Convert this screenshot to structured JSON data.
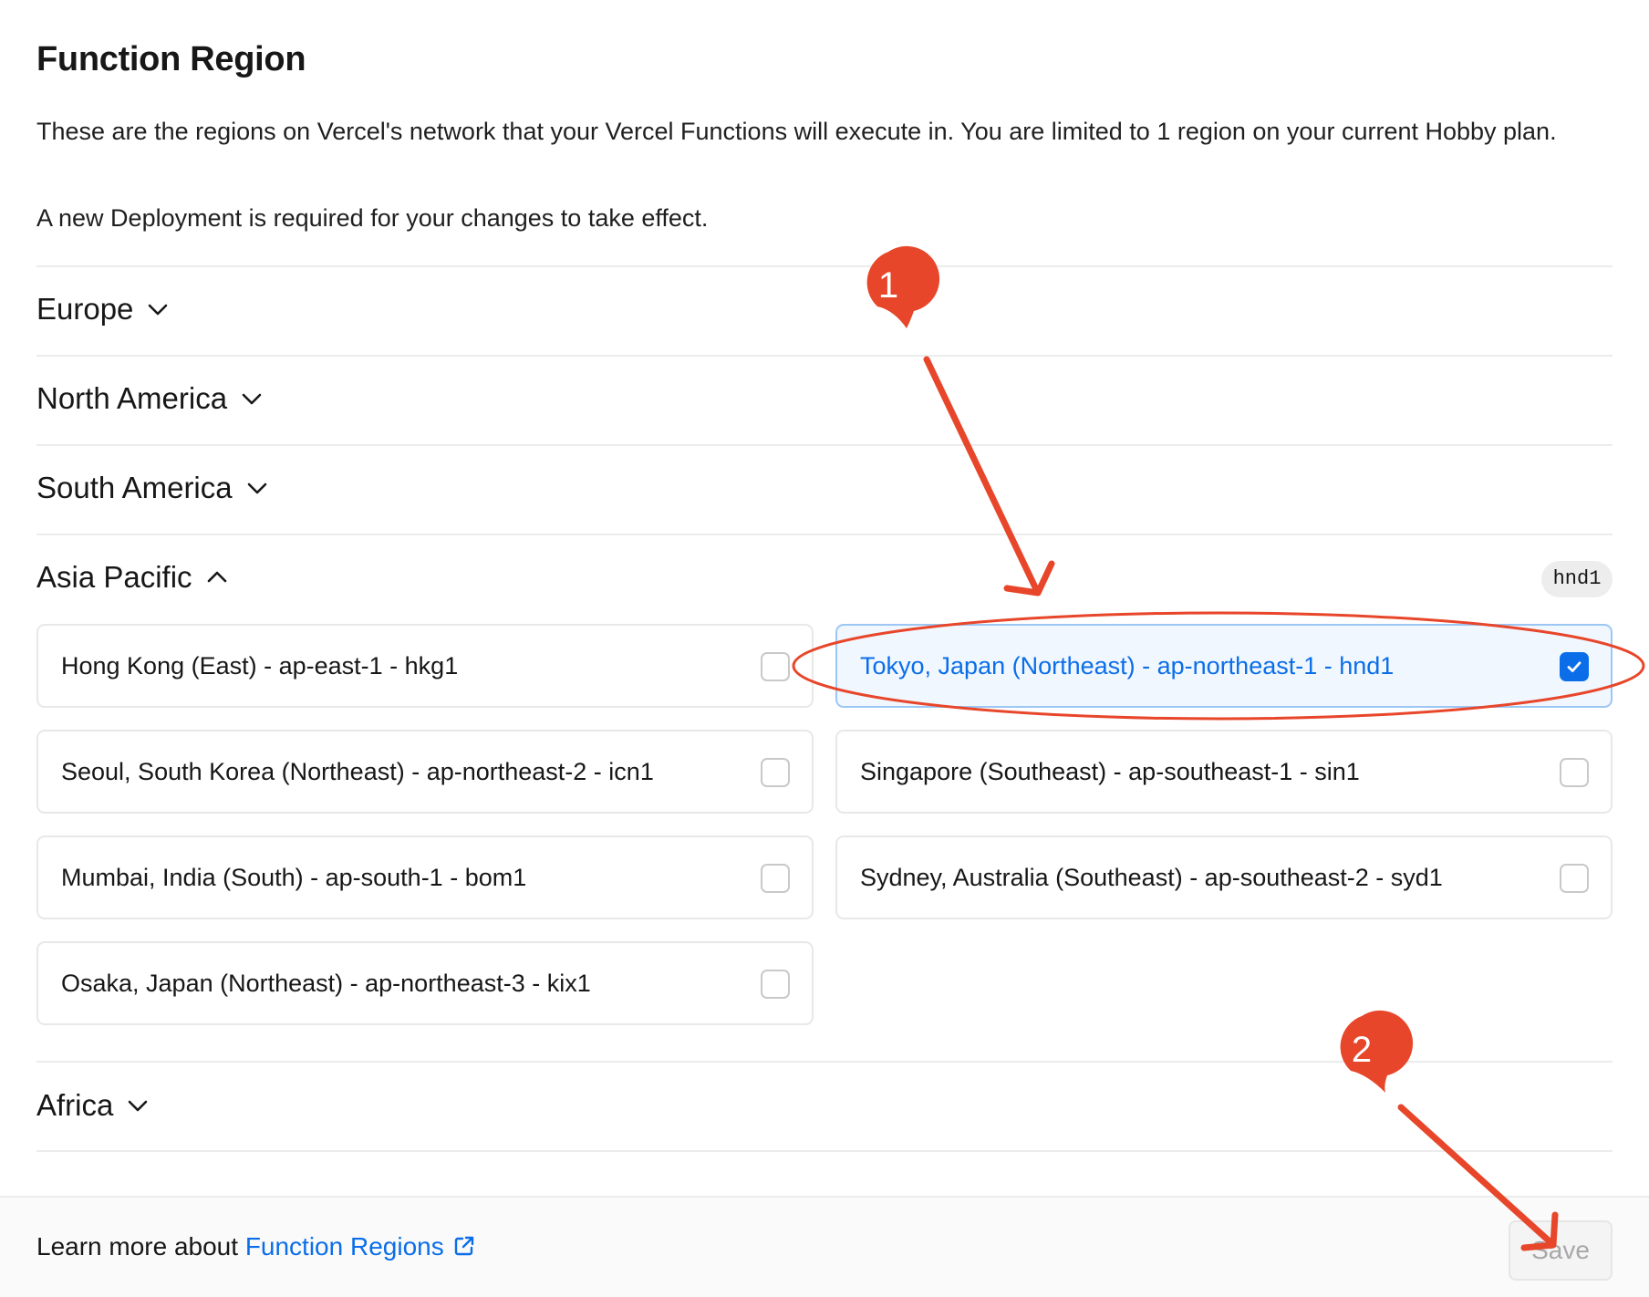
{
  "header": {
    "title": "Function Region",
    "description": "These are the regions on Vercel's network that your Vercel Functions will execute in. You are limited to 1 region on your current Hobby plan.",
    "note": "A new Deployment is required for your changes to take effect."
  },
  "groups": {
    "europe": {
      "label": "Europe",
      "expanded": false
    },
    "north_america": {
      "label": "North America",
      "expanded": false
    },
    "south_america": {
      "label": "South America",
      "expanded": false
    },
    "asia_pacific": {
      "label": "Asia Pacific",
      "expanded": true,
      "selected_badge": "hnd1"
    },
    "africa": {
      "label": "Africa",
      "expanded": false
    }
  },
  "asia_pacific_options": [
    {
      "label": "Hong Kong (East) - ap-east-1 - hkg1",
      "checked": false
    },
    {
      "label": "Tokyo, Japan (Northeast) - ap-northeast-1 - hnd1",
      "checked": true
    },
    {
      "label": "Seoul, South Korea (Northeast) - ap-northeast-2 - icn1",
      "checked": false
    },
    {
      "label": "Singapore (Southeast) - ap-southeast-1 - sin1",
      "checked": false
    },
    {
      "label": "Mumbai, India (South) - ap-south-1 - bom1",
      "checked": false
    },
    {
      "label": "Sydney, Australia (Southeast) - ap-southeast-2 - syd1",
      "checked": false
    },
    {
      "label": "Osaka, Japan (Northeast) - ap-northeast-3 - kix1",
      "checked": false
    }
  ],
  "footer": {
    "prefix": "Learn more about ",
    "link": "Function Regions",
    "save_label": "Save",
    "save_disabled": true
  },
  "annotations": {
    "marker1": "1",
    "marker2": "2"
  },
  "colors": {
    "accent": "#0b6ee8",
    "annotation": "#e8462a"
  },
  "icons": [
    "chevron-down-icon",
    "chevron-up-icon",
    "checkmark-icon",
    "external-link-icon"
  ]
}
